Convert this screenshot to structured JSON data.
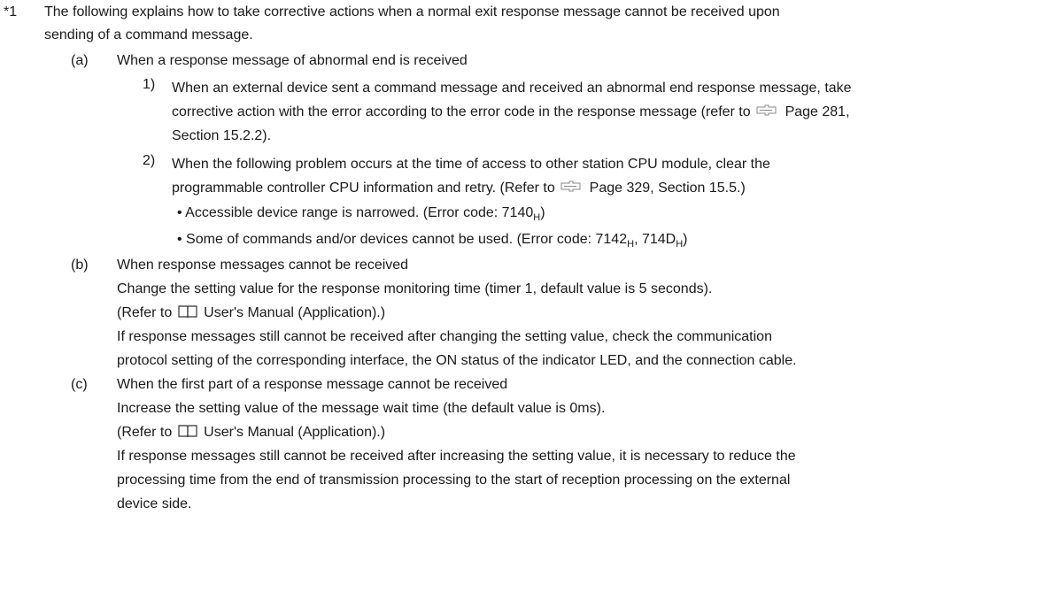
{
  "note": {
    "marker": "*1",
    "intro_1": "The following explains how to take corrective actions when a normal exit response message cannot be received upon",
    "intro_2": "sending of a command message."
  },
  "item_a": {
    "label": "(a)",
    "heading": "When a response message of abnormal end is received",
    "sub1": {
      "number": "1)",
      "line1": "When an external device sent a command message and received an abnormal end response message, take",
      "line2_pre": "corrective action with the error according to the error code in the response message (refer to",
      "line2_ref": "Page 281,",
      "line3": "Section 15.2.2)."
    },
    "sub2": {
      "number": "2)",
      "line1": "When the following problem occurs at the time of access to other station CPU module, clear the",
      "line2_pre": "programmable controller CPU information and retry. (Refer to",
      "line2_ref": "Page 329, Section 15.5.)",
      "bullet1_text": "• Accessible device range is narrowed. (Error code: 7140",
      "bullet1_sub": "H",
      "bullet1_end": ")",
      "bullet2_text": "• Some of commands and/or devices cannot be used. (Error code: 7142",
      "bullet2_sub1": "H",
      "bullet2_mid": ", 714D",
      "bullet2_sub2": "H",
      "bullet2_end": ")"
    }
  },
  "item_b": {
    "label": "(b)",
    "heading": "When response messages cannot be received",
    "line1": "Change the setting value for the response monitoring time (timer 1, default value is 5 seconds).",
    "line2_pre": "(Refer to",
    "line2_post": "User's Manual (Application).)",
    "line3": "If response messages still cannot be received after changing the setting value, check the communication",
    "line4": "protocol setting of the corresponding interface, the ON status of the indicator LED, and the connection cable."
  },
  "item_c": {
    "label": "(c)",
    "heading": "When the first part of a response message cannot be received",
    "line1": "Increase the setting value of the message wait time (the default value is 0ms).",
    "line2_pre": "(Refer to",
    "line2_post": "User's Manual (Application).)",
    "line3": "If response messages still cannot be received after increasing the setting value, it is necessary to reduce the",
    "line4": "processing time from the end of transmission processing to the start of reception processing on the external",
    "line5": "device side."
  }
}
